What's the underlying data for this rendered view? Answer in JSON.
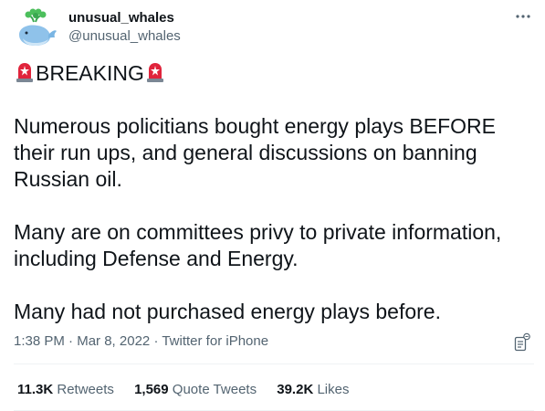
{
  "author": {
    "display_name": "unusual_whales",
    "handle": "@unusual_whales",
    "avatar_icon": "whale-icon"
  },
  "tweet": {
    "breaking": "BREAKING",
    "lines": [
      "Numerous policitians bought energy plays BEFORE",
      "their run ups, and general discussions on banning",
      "Russian oil.",
      "Many are on committees privy to private information,",
      "including Defense and Energy.",
      "Many had not purchased energy plays before."
    ]
  },
  "meta": {
    "time": "1:38 PM",
    "separator": "·",
    "date": "Mar 8, 2022",
    "source": "Twitter for iPhone"
  },
  "stats": {
    "retweets_count": "11.3K",
    "retweets_label": "Retweets",
    "quotes_count": "1,569",
    "quotes_label": "Quote Tweets",
    "likes_count": "39.2K",
    "likes_label": "Likes"
  },
  "colors": {
    "text": "#0f1419",
    "secondary": "#536471",
    "divider": "#eff3f4",
    "siren_red": "#e0243c",
    "whale_blue": "#8fc2ea"
  }
}
